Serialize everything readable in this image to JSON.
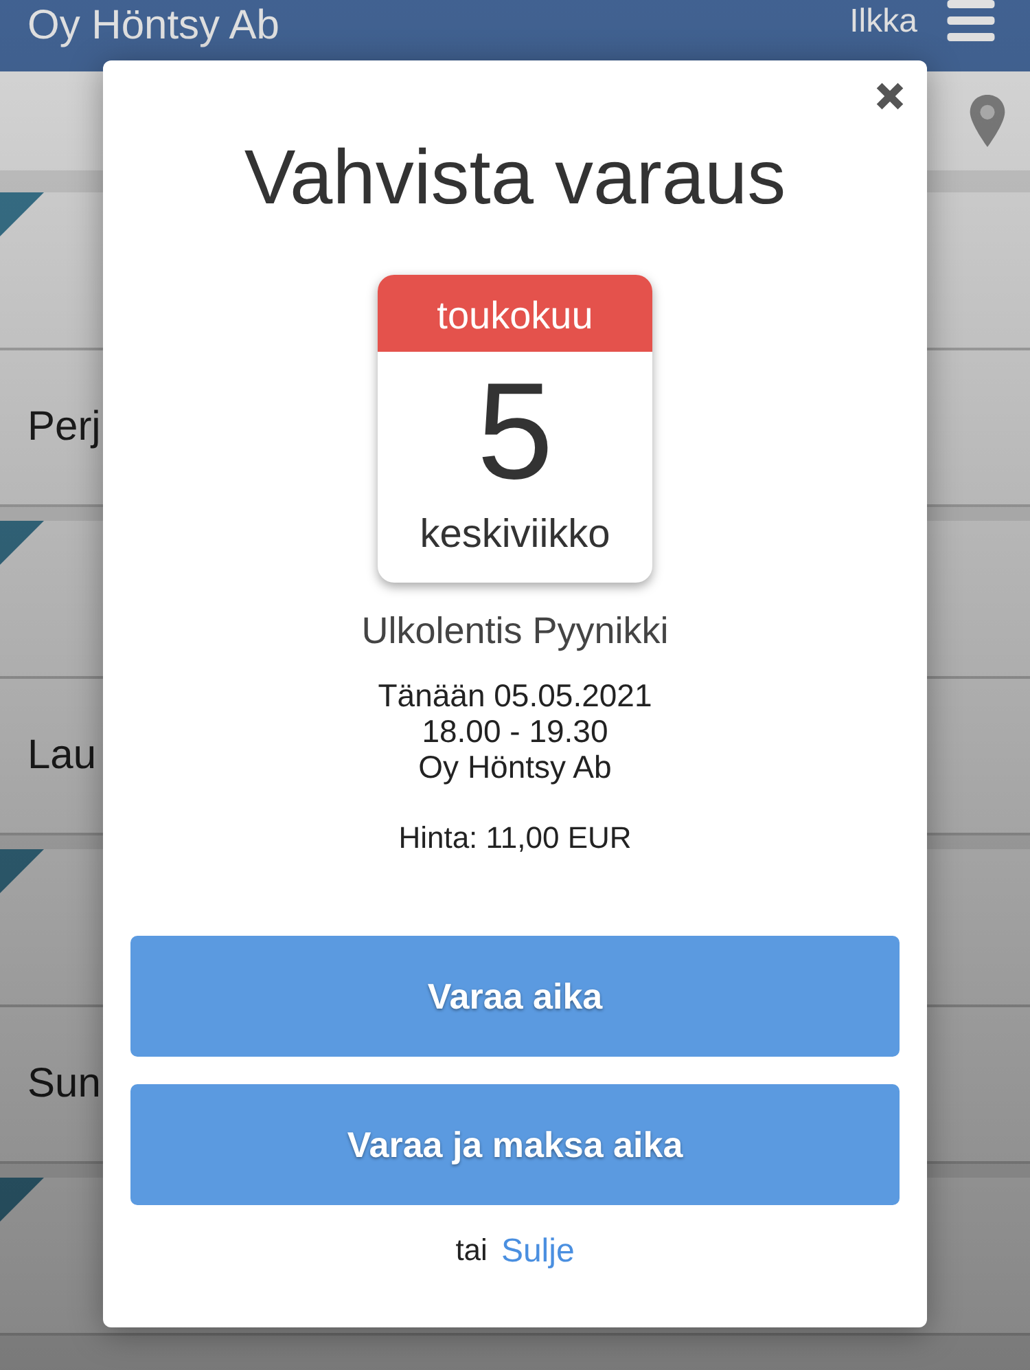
{
  "header": {
    "title": "Oy Höntsy Ab",
    "user": "Ilkka"
  },
  "rows": [
    {
      "kind": "slot"
    },
    {
      "kind": "day",
      "label": "Perj"
    },
    {
      "kind": "slot"
    },
    {
      "kind": "day",
      "label": "Lau"
    },
    {
      "kind": "slot"
    },
    {
      "kind": "day",
      "label": "Sun"
    },
    {
      "kind": "slot"
    }
  ],
  "modal": {
    "title": "Vahvista varaus",
    "calendar": {
      "month": "toukokuu",
      "day": "5",
      "weekday": "keskiviikko"
    },
    "venue": "Ulkolentis Pyynikki",
    "details": [
      "Tänään 05.05.2021",
      "18.00 - 19.30",
      "Oy Höntsy Ab"
    ],
    "price": "Hinta: 11,00 EUR",
    "buttons": [
      "Varaa aika",
      "Varaa ja maksa aika"
    ],
    "footer": {
      "prefix": "tai",
      "link": "Sulje"
    }
  }
}
